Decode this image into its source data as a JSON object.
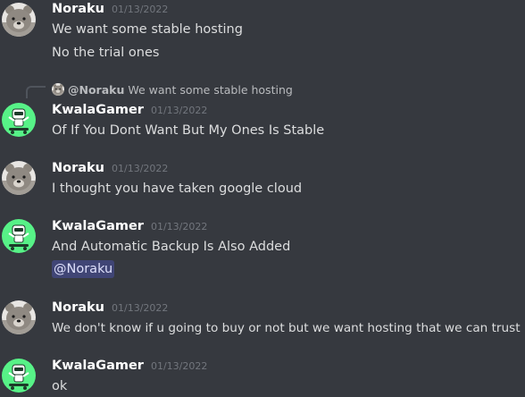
{
  "colors": {
    "background": "#36393f",
    "username": "#ffffff",
    "timestamp": "#72767d",
    "text": "#dcddde",
    "mention_bg": "#414675",
    "kwala_avatar_bg": "#57f287"
  },
  "reply": {
    "author": "@Noraku",
    "text": "We want some stable hosting",
    "avatar_icon": "bear-avatar-icon"
  },
  "messages": [
    {
      "author": "Noraku",
      "timestamp": "01/13/2022",
      "avatar_icon": "bear-avatar-icon",
      "lines": [
        "We want some stable hosting",
        "No the trial ones"
      ]
    },
    {
      "author": "KwalaGamer",
      "timestamp": "01/13/2022",
      "avatar_icon": "skateboard-robot-avatar-icon",
      "lines": [
        "Of If You Dont Want But My Ones Is Stable"
      ]
    },
    {
      "author": "Noraku",
      "timestamp": "01/13/2022",
      "avatar_icon": "bear-avatar-icon",
      "lines": [
        "I thought you have taken google cloud"
      ]
    },
    {
      "author": "KwalaGamer",
      "timestamp": "01/13/2022",
      "avatar_icon": "skateboard-robot-avatar-icon",
      "lines": [
        "And Automatic Backup Is Also Added"
      ],
      "mention": "@Noraku"
    },
    {
      "author": "Noraku",
      "timestamp": "01/13/2022",
      "avatar_icon": "bear-avatar-icon",
      "lines": [
        "We don't know if u going to buy or not but we want hosting that we can trust"
      ]
    },
    {
      "author": "KwalaGamer",
      "timestamp": "01/13/2022",
      "avatar_icon": "skateboard-robot-avatar-icon",
      "lines": [
        "ok"
      ]
    }
  ]
}
